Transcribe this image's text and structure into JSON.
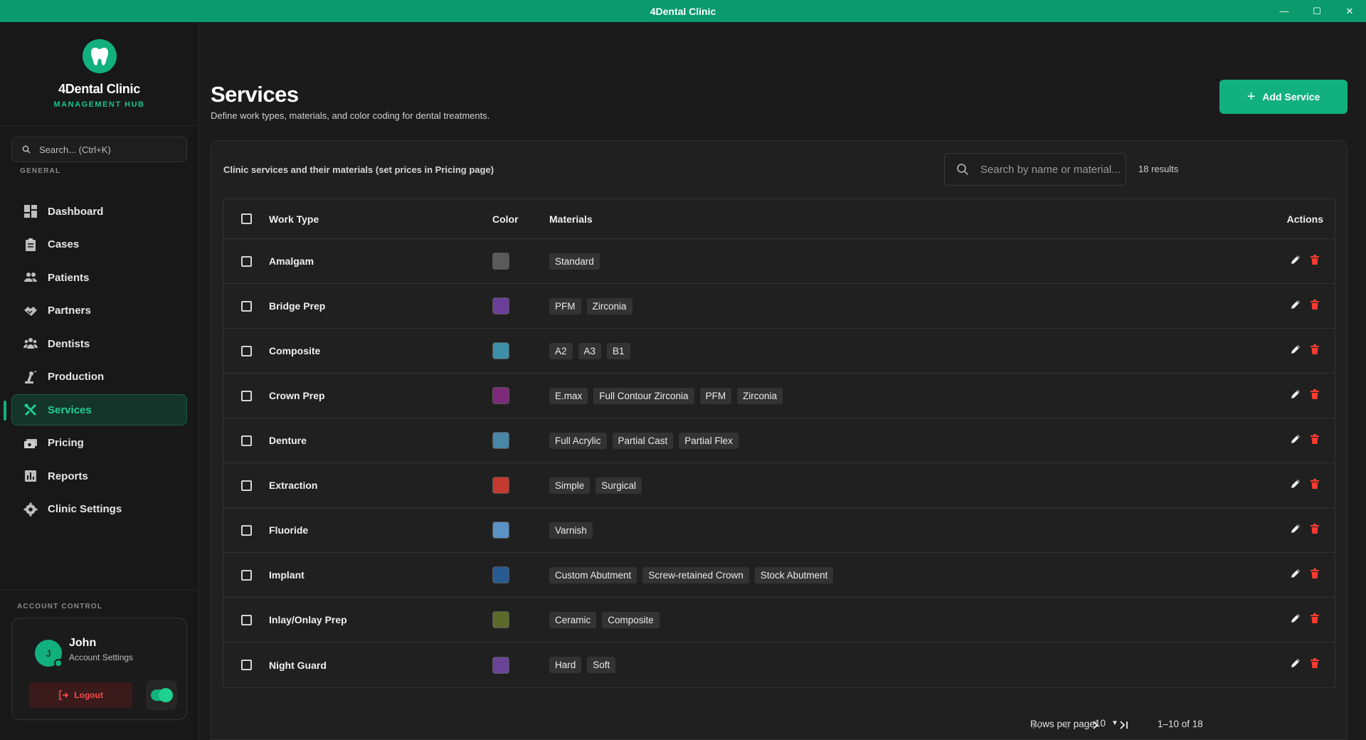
{
  "window": {
    "title": "4Dental Clinic"
  },
  "brand": {
    "name": "4Dental Clinic",
    "subtitle": "MANAGEMENT HUB"
  },
  "sidebar": {
    "search_placeholder": "Search... (Ctrl+K)",
    "section_general": "GENERAL",
    "items": [
      {
        "label": "Dashboard",
        "icon": "dashboard-icon"
      },
      {
        "label": "Cases",
        "icon": "clipboard-icon"
      },
      {
        "label": "Patients",
        "icon": "people-icon"
      },
      {
        "label": "Partners",
        "icon": "handshake-icon"
      },
      {
        "label": "Dentists",
        "icon": "group-icon"
      },
      {
        "label": "Production",
        "icon": "precision-tool-icon"
      },
      {
        "label": "Services",
        "icon": "tools-icon",
        "active": true
      },
      {
        "label": "Pricing",
        "icon": "money-icon"
      },
      {
        "label": "Reports",
        "icon": "bar-chart-icon"
      },
      {
        "label": "Clinic Settings",
        "icon": "gear-icon"
      }
    ],
    "section_account": "ACCOUNT CONTROL"
  },
  "account": {
    "initial": "J",
    "name": "John",
    "subtitle": "Account Settings",
    "logout_label": "Logout"
  },
  "page": {
    "title": "Services",
    "subtitle": "Define work types, materials, and color coding for dental treatments.",
    "add_button": "Add Service"
  },
  "table": {
    "caption": "Clinic services and their materials (set prices in Pricing page)",
    "search_placeholder": "Search by name or material...",
    "results": "18 results",
    "headers": {
      "work_type": "Work Type",
      "color": "Color",
      "materials": "Materials",
      "actions": "Actions"
    },
    "rows": [
      {
        "work_type": "Amalgam",
        "color": "#5a5a5a",
        "materials": [
          "Standard"
        ]
      },
      {
        "work_type": "Bridge Prep",
        "color": "#6b3f99",
        "materials": [
          "PFM",
          "Zirconia"
        ]
      },
      {
        "work_type": "Composite",
        "color": "#3e8fa8",
        "materials": [
          "A2",
          "A3",
          "B1"
        ]
      },
      {
        "work_type": "Crown Prep",
        "color": "#7d2a7a",
        "materials": [
          "E.max",
          "Full Contour Zirconia",
          "PFM",
          "Zirconia"
        ]
      },
      {
        "work_type": "Denture",
        "color": "#4a86a6",
        "materials": [
          "Full Acrylic",
          "Partial Cast",
          "Partial Flex"
        ]
      },
      {
        "work_type": "Extraction",
        "color": "#c43a2e",
        "materials": [
          "Simple",
          "Surgical"
        ]
      },
      {
        "work_type": "Fluoride",
        "color": "#5b92c4",
        "materials": [
          "Varnish"
        ]
      },
      {
        "work_type": "Implant",
        "color": "#285a94",
        "materials": [
          "Custom Abutment",
          "Screw-retained Crown",
          "Stock Abutment"
        ]
      },
      {
        "work_type": "Inlay/Onlay Prep",
        "color": "#5d6a2a",
        "materials": [
          "Ceramic",
          "Composite"
        ]
      },
      {
        "work_type": "Night Guard",
        "color": "#6a4496",
        "materials": [
          "Hard",
          "Soft"
        ]
      }
    ]
  },
  "pagination": {
    "rows_label": "Rows per page:",
    "rows_value": "10",
    "range": "1–10 of 18"
  },
  "colors": {
    "accent": "#12b07c",
    "delete": "#ff3b30"
  }
}
